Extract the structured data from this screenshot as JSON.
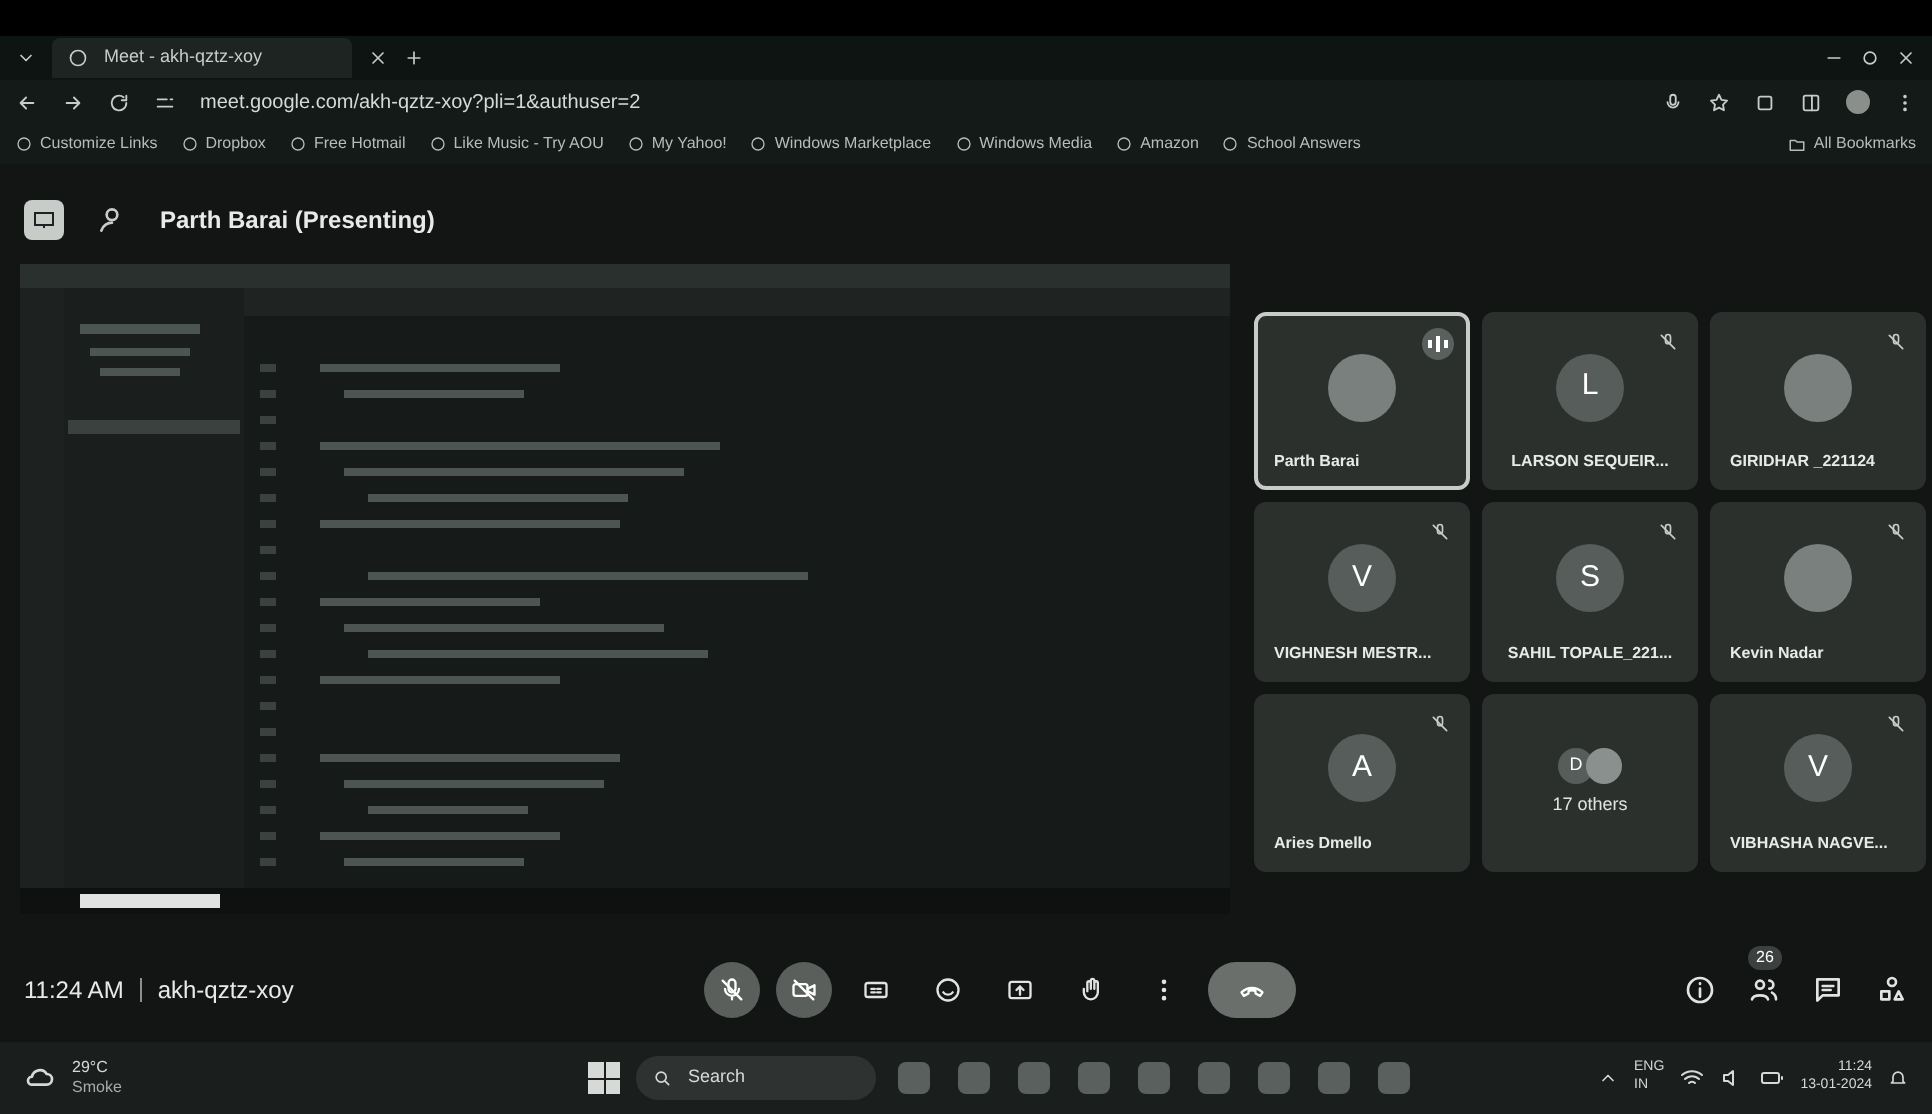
{
  "browser": {
    "tab_title": "Meet - akh-qztz-xoy",
    "url": "meet.google.com/akh-qztz-xoy?pli=1&authuser=2",
    "bookmarks": [
      "Customize Links",
      "Dropbox",
      "Free Hotmail",
      "Like Music - Try AOU",
      "My Yahoo!",
      "Windows Marketplace",
      "Windows Media",
      "Amazon",
      "School Answers"
    ],
    "all_bookmarks": "All Bookmarks"
  },
  "meet": {
    "presenter_label": "Parth Barai (Presenting)",
    "tiles": [
      {
        "name": "Parth Barai",
        "kind": "photo",
        "speaking": true,
        "muted": false
      },
      {
        "name": "LARSON SEQUEIR...",
        "kind": "letter",
        "letter": "L",
        "speaking": false,
        "muted": true
      },
      {
        "name": "GIRIDHAR _221124",
        "kind": "photo",
        "speaking": false,
        "muted": true
      },
      {
        "name": "VIGHNESH MESTR...",
        "kind": "letter",
        "letter": "V",
        "speaking": false,
        "muted": true
      },
      {
        "name": "SAHIL TOPALE_221...",
        "kind": "letter",
        "letter": "S",
        "speaking": false,
        "muted": true
      },
      {
        "name": "Kevin Nadar",
        "kind": "photo",
        "speaking": false,
        "muted": true
      },
      {
        "name": "Aries Dmello",
        "kind": "letter",
        "letter": "A",
        "speaking": false,
        "muted": true
      },
      {
        "name": "17 others",
        "kind": "group",
        "letter": "D",
        "speaking": false,
        "muted": false
      },
      {
        "name": "VIBHASHA NAGVE...",
        "kind": "letter",
        "letter": "V",
        "speaking": false,
        "muted": true
      }
    ],
    "time": "11:24 AM",
    "meeting_code": "akh-qztz-xoy",
    "controls": [
      {
        "kind": "mic",
        "off": true
      },
      {
        "kind": "camera",
        "off": true
      },
      {
        "kind": "captions",
        "off": false
      },
      {
        "kind": "emoji",
        "off": false
      },
      {
        "kind": "present",
        "off": false
      },
      {
        "kind": "hand",
        "off": false
      },
      {
        "kind": "more",
        "off": false
      },
      {
        "kind": "end",
        "off": false
      }
    ],
    "people_count": "26"
  },
  "taskbar": {
    "temperature": "29°C",
    "weather": "Smoke",
    "search": "Search",
    "language": "ENG",
    "region": "IN",
    "clock_time": "11:24",
    "clock_date": "13-01-2024"
  }
}
